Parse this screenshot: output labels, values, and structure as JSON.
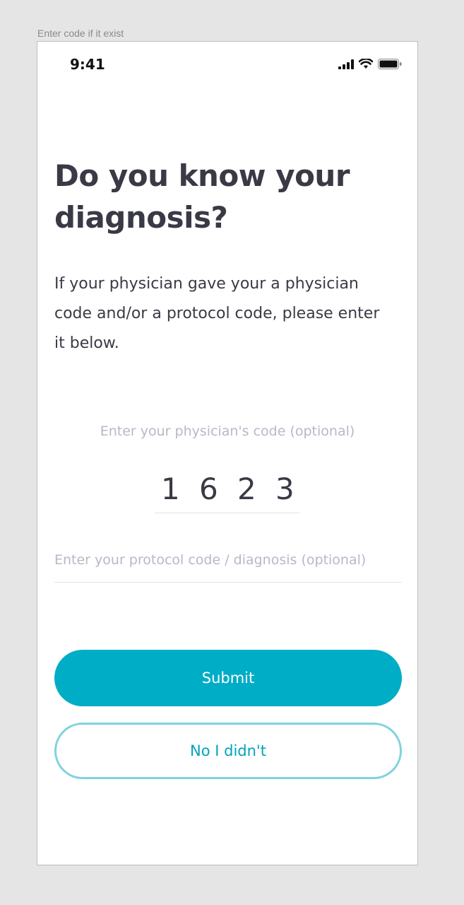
{
  "frame": {
    "label": "Enter code if it exist"
  },
  "status_bar": {
    "time": "9:41",
    "icons": [
      "cellular-signal-icon",
      "wifi-icon",
      "battery-icon"
    ]
  },
  "content": {
    "headline": "Do you know your diagnosis?",
    "description": "If your physician gave your a physician code and/or a protocol code, please enter it below."
  },
  "physician_code": {
    "label": "Enter your physician's code (optional)",
    "digits": [
      "1",
      "6",
      "2",
      "3"
    ]
  },
  "protocol_code": {
    "placeholder": "Enter your protocol code / diagnosis (optional)",
    "value": ""
  },
  "actions": {
    "submit_label": "Submit",
    "decline_label": "No I didn't"
  },
  "colors": {
    "accent": "#00adc6",
    "secondary_border": "#7fd3df",
    "text_primary": "#3a3a46",
    "placeholder": "#b8b8c8",
    "canvas_bg": "#e5e5e5"
  }
}
